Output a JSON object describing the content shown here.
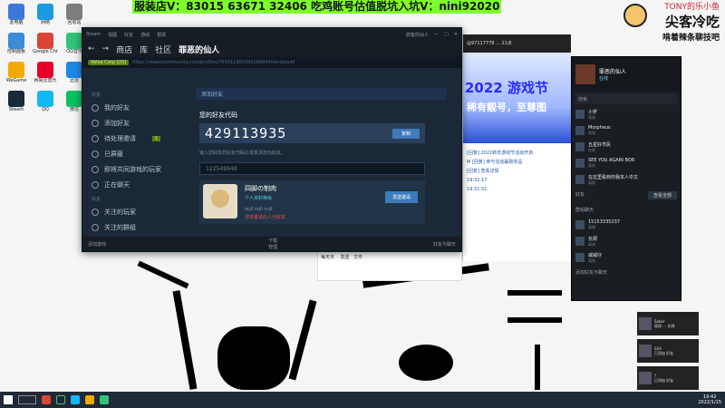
{
  "overlay": {
    "banner": "服装店V：83015 63671 32406 吃鸡账号估值脱坑入坑V：nini92020",
    "streamer_nick": "TONY的乐小鱼",
    "streamer_title1": "尖客冷吃",
    "streamer_title2": "啃着辣条聊技吧"
  },
  "desktop_icons": [
    {
      "label": "此电脑",
      "color": "#3c78d8"
    },
    {
      "label": "网络",
      "color": "#1b9adf"
    },
    {
      "label": "回收站",
      "color": "#7d7d7d"
    },
    {
      "label": "控制面板",
      "color": "#3b8cd4"
    },
    {
      "label": "Google Chrome",
      "color": "#db4437"
    },
    {
      "label": "QQ音乐",
      "color": "#31c27c"
    },
    {
      "label": "WeGame",
      "color": "#f2a900"
    },
    {
      "label": "网易云音乐",
      "color": "#e60026"
    },
    {
      "label": "迅雷",
      "color": "#1e88e5"
    },
    {
      "label": "Steam",
      "color": "#1b2838"
    },
    {
      "label": "QQ",
      "color": "#12b7f5"
    },
    {
      "label": "微信",
      "color": "#07c160"
    }
  ],
  "steam": {
    "titlebar_items": [
      "Steam",
      "视图",
      "好友",
      "游戏",
      "帮助"
    ],
    "titlebar_right": "旅客的仙人",
    "nav_brand": "商店",
    "nav_items": [
      "库",
      "社区"
    ],
    "nav_user": "罪恶的仙人",
    "verified_label": "Valve Corp [US]",
    "url": "https://steamcommunity.com/profiles/76561198039318844/friends/add",
    "sidebar_section1": "好友",
    "sidebar_items": [
      {
        "label": "我的好友",
        "new": ""
      },
      {
        "label": "添加好友",
        "new": ""
      },
      {
        "label": "待处理邀请",
        "new": "1"
      },
      {
        "label": "已屏蔽",
        "new": ""
      },
      {
        "label": "即将共同游戏的玩家",
        "new": ""
      },
      {
        "label": "正在聊天",
        "new": ""
      }
    ],
    "sidebar_section2": "好友",
    "sidebar_items2": [
      {
        "label": "关注的玩家"
      },
      {
        "label": "关注的群组"
      }
    ],
    "content_head": "添加好友",
    "code_label": "您的好友代码",
    "friend_code": "429113935",
    "copy_button": "复制",
    "hint": "输入您好友的好友代码以将其添加为好友。",
    "search_value": "122549948",
    "result_name": "四脚の制肉",
    "result_level": "个人资料等级",
    "result_nick": "null null null",
    "result_warn": "您将邀请此人为好友",
    "send_button": "发送邀请",
    "bottom_left": "添加游戏",
    "bottom_mid1": "下载",
    "bottom_mid2": "管理",
    "bottom_right": "好友与聊天"
  },
  "browser": {
    "header": "@97117778  ...  21点",
    "promo_title": "2022 游戏节",
    "promo_sub": "稀有靓号，至尊图",
    "lines": [
      "[回复]  2022新年游戏节活动开启",
      "M [回复] 参与活动赢取奖品",
      "[回复] 查看详情",
      "19:32:17",
      "19:31:51"
    ]
  },
  "chat": {
    "user_name": "罪恶的仙人",
    "user_status": "在线",
    "search_placeholder": "搜索",
    "friends": [
      {
        "name": "小罗",
        "status": "离线"
      },
      {
        "name": "Morpheus",
        "status": "离线"
      },
      {
        "name": "五星好市民",
        "status": "在线"
      },
      {
        "name": "SEE YOU AGAIN BOR",
        "status": "离线"
      },
      {
        "name": "在这里看到你我本人中文",
        "status": "离线"
      }
    ],
    "section_label": "好友",
    "section_btn": "查看全部",
    "group_label": "群组聊天",
    "groups": [
      {
        "name": "15153335237",
        "status": "离线"
      },
      {
        "name": "长颈",
        "status": "离线"
      },
      {
        "name": "威威仔",
        "status": "离线"
      }
    ],
    "footer": "添加好友与聊天"
  },
  "notifications": [
    {
      "title": "Saber",
      "line": "离线 ⋯ 在线"
    },
    {
      "title": "SSA",
      "line": "已添加 好友"
    },
    {
      "title": "?",
      "line": "已添加 好友"
    }
  ],
  "qqbar": {
    "name": "每天天",
    "label": "发送",
    "label2": "文件"
  },
  "taskbar": {
    "time": "19:42",
    "date": "2022/1/15"
  }
}
